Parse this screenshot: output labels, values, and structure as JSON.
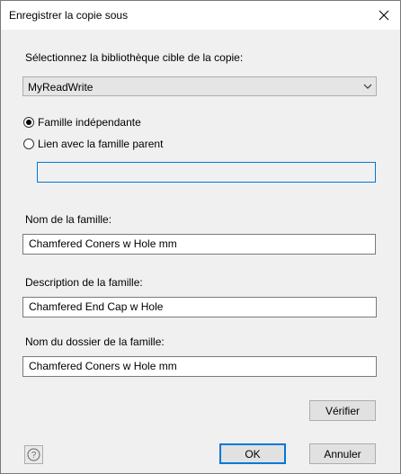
{
  "window": {
    "title": "Enregistrer la copie sous"
  },
  "library": {
    "label": "Sélectionnez la bibliothèque cible de la copie:",
    "selected": "MyReadWrite"
  },
  "options": {
    "independent_label": "Famille indépendante",
    "independent_checked": true,
    "link_parent_label": "Lien avec la famille parent",
    "link_parent_checked": false,
    "parent_field_value": ""
  },
  "family_name": {
    "label": "Nom de la famille:",
    "value": "Chamfered Coners w Hole mm"
  },
  "family_description": {
    "label": "Description de la famille:",
    "value": "Chamfered End Cap w Hole"
  },
  "family_folder": {
    "label": "Nom du dossier de la famille:",
    "value": "Chamfered Coners w Hole mm"
  },
  "buttons": {
    "verify": "Vérifier",
    "ok": "OK",
    "cancel": "Annuler"
  },
  "icons": {
    "close": "close-icon",
    "dropdown": "chevron-down-icon",
    "help": "help-icon"
  }
}
